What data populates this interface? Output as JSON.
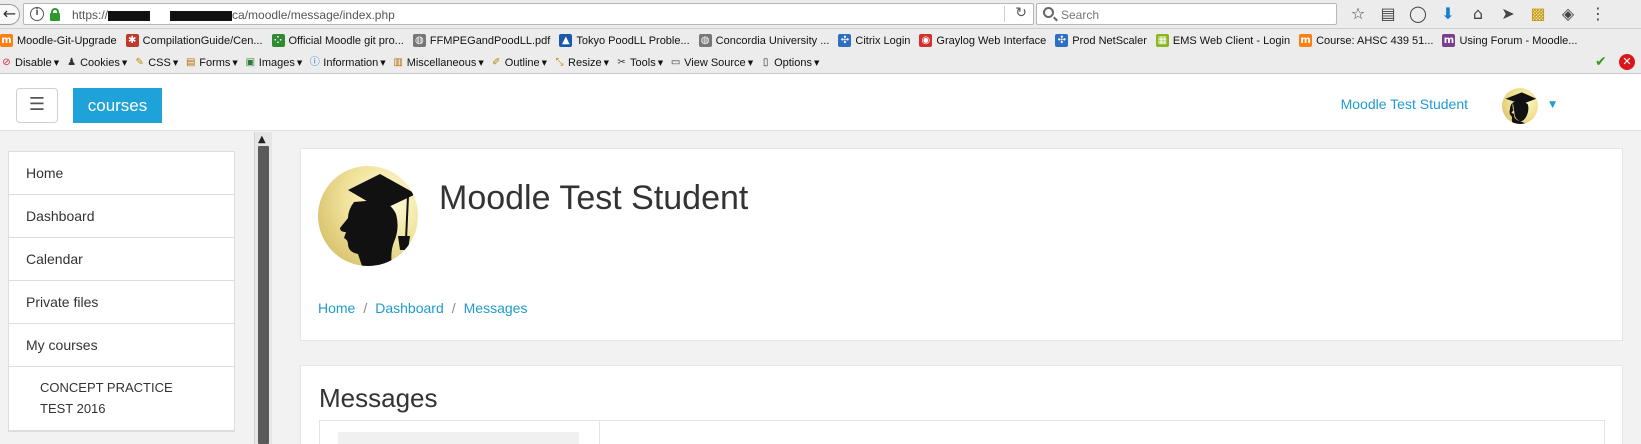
{
  "browser": {
    "url_prefix": "https://",
    "url_suffix": "ca/moodle/message/index.php",
    "search_placeholder": "Search"
  },
  "bookmarks": [
    {
      "label": "Moodle-Git-Upgrade",
      "icon": "moodle-icon",
      "color": "#f98012"
    },
    {
      "label": "CompilationGuide/Cen...",
      "icon": "bug-icon",
      "color": "#c0392b"
    },
    {
      "label": "Official Moodle git pro...",
      "icon": "grid-icon",
      "color": "#2e8b2e"
    },
    {
      "label": "FFMPEGandPoodLL.pdf",
      "icon": "globe-icon",
      "color": "#777777"
    },
    {
      "label": "Tokyo PoodLL Proble...",
      "icon": "drop-icon",
      "color": "#1b5aa8"
    },
    {
      "label": "Concordia University ...",
      "icon": "globe-icon",
      "color": "#777777"
    },
    {
      "label": "Citrix Login",
      "icon": "citrix-icon",
      "color": "#2f6fc1"
    },
    {
      "label": "Graylog Web Interface",
      "icon": "graylog-icon",
      "color": "#d0312d"
    },
    {
      "label": "Prod NetScaler",
      "icon": "citrix-icon",
      "color": "#2f6fc1"
    },
    {
      "label": "EMS Web Client - Login",
      "icon": "ems-icon",
      "color": "#8ab51c"
    },
    {
      "label": "Course: AHSC 439 51...",
      "icon": "moodle-icon",
      "color": "#f98012"
    },
    {
      "label": "Using Forum - Moodle...",
      "icon": "moodle-m-icon",
      "color": "#7a3e8e"
    }
  ],
  "devbar": [
    {
      "label": "Disable",
      "icon": "disable-icon"
    },
    {
      "label": "Cookies",
      "icon": "cookie-icon"
    },
    {
      "label": "CSS",
      "icon": "css-pencil-icon"
    },
    {
      "label": "Forms",
      "icon": "forms-icon"
    },
    {
      "label": "Images",
      "icon": "images-icon"
    },
    {
      "label": "Information",
      "icon": "info-icon"
    },
    {
      "label": "Miscellaneous",
      "icon": "misc-icon"
    },
    {
      "label": "Outline",
      "icon": "outline-icon"
    },
    {
      "label": "Resize",
      "icon": "resize-icon"
    },
    {
      "label": "Tools",
      "icon": "tools-icon"
    },
    {
      "label": "View Source",
      "icon": "source-icon"
    },
    {
      "label": "Options",
      "icon": "options-icon"
    }
  ],
  "moodle": {
    "brand": "courses",
    "user_name": "Moodle Test Student",
    "accent": "#1fa2d8"
  },
  "drawer": {
    "items": [
      "Home",
      "Dashboard",
      "Calendar",
      "Private files",
      "My courses"
    ],
    "course": "CONCEPT PRACTICE TEST 2016"
  },
  "main": {
    "title": "Moodle Test Student",
    "breadcrumb": [
      "Home",
      "Dashboard",
      "Messages"
    ],
    "section_title": "Messages"
  }
}
